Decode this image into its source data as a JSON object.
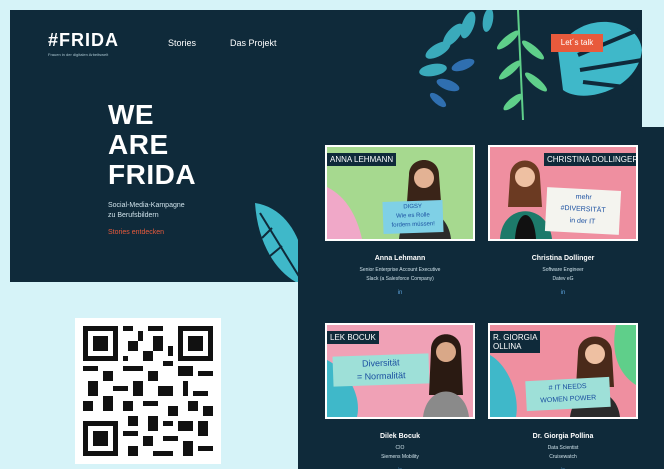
{
  "header": {
    "logo": "#FRIDA",
    "tagline": "Frauen in der digitalen Arbeitswelt",
    "nav": [
      "Stories",
      "Das Projekt"
    ],
    "cta": "Let´s talk"
  },
  "hero": {
    "headline": [
      "WE",
      "ARE",
      "FRIDA"
    ],
    "subtitle": [
      "Social-Media-Kampagne",
      "zu Berufsbildern"
    ],
    "link": "Stories entdecken"
  },
  "cards": [
    {
      "label": "ANNA LEHMANN",
      "sign": [
        "DIGSY",
        "Wie es Rolle",
        "fordern müssen!"
      ],
      "name": "Anna Lehmann",
      "role": "Senior Enterprise Account Executive",
      "company": "Slack (a Salesforce Company)",
      "link": "in"
    },
    {
      "label": "CHRISTINA DOLLINGER",
      "sign": [
        "mehr",
        "#DIVERSITÄT",
        "in der IT"
      ],
      "name": "Christina Dollinger",
      "role": "Software Engineer",
      "company": "Datev eG",
      "link": "in"
    },
    {
      "label": "LEK BOCUK",
      "sign": [
        "Diversität",
        "= Normalität"
      ],
      "name": "Dilek Bocuk",
      "role": "CIO",
      "company": "Siemens Mobility",
      "link": "in"
    },
    {
      "label": "R. GIORGIA\nOLLINA",
      "sign": [
        "# IT NEEDS",
        "WOMEN POWER"
      ],
      "name": "Dr. Giorgia Pollina",
      "role": "Data Scientist",
      "company": "Cruisewatch",
      "link": "in"
    }
  ],
  "colors": {
    "navy": "#0f2a3a",
    "accent": "#e85a3c",
    "page": "#d6f3f8",
    "leaf": "#3fb8c9"
  }
}
